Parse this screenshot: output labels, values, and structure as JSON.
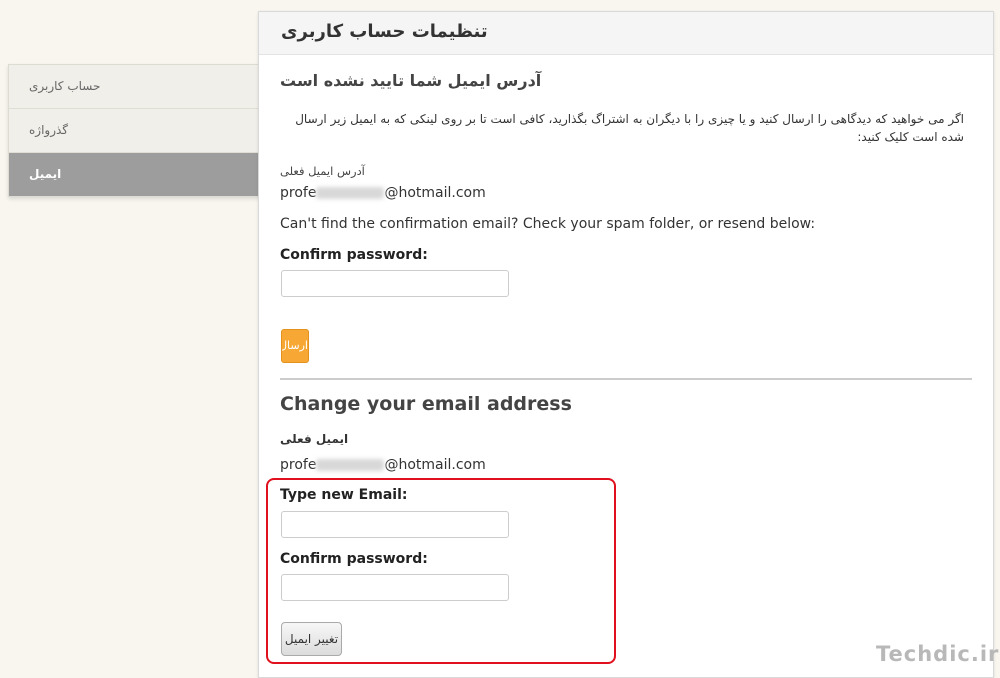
{
  "sidebar": {
    "items": [
      {
        "label": "حساب کاربری",
        "active": false
      },
      {
        "label": "گذرواژه",
        "active": false
      },
      {
        "label": "ایمیل",
        "active": true
      }
    ]
  },
  "panel": {
    "title": "تنظیمات حساب کاربری"
  },
  "unverified": {
    "heading": "آدرس ایمیل شما تایید نشده است",
    "instructions": "اگر می خواهید که دیدگاهی را ارسال کنید و یا چیزی را با دیگران به اشتراگ بگذارید، کافی است تا بر روی لینکی که به ایمیل زیر ارسال شده است کلیک کنید:",
    "current_email_label": "آدرس ایمیل فعلی",
    "email_prefix": "profe",
    "email_suffix": "@hotmail.com",
    "cant_find": "Can't find the confirmation email? Check your spam folder, or resend below:",
    "confirm_password_label": "Confirm password:",
    "confirm_password_value": "",
    "send_button": "ارسال"
  },
  "change_email": {
    "heading": "Change your email address",
    "current_email_label": "ایمیل فعلی",
    "email_prefix": "profe",
    "email_suffix": "@hotmail.com",
    "new_email_label": "Type new Email:",
    "new_email_value": "",
    "confirm_password_label": "Confirm password:",
    "confirm_password_value": "",
    "change_button": "تغییر ایمیل"
  },
  "watermark": "Techdic.ir",
  "colors": {
    "accent_button": "#f7a834",
    "highlight_border": "#e0101e",
    "sidebar_active": "#9d9d9d"
  }
}
